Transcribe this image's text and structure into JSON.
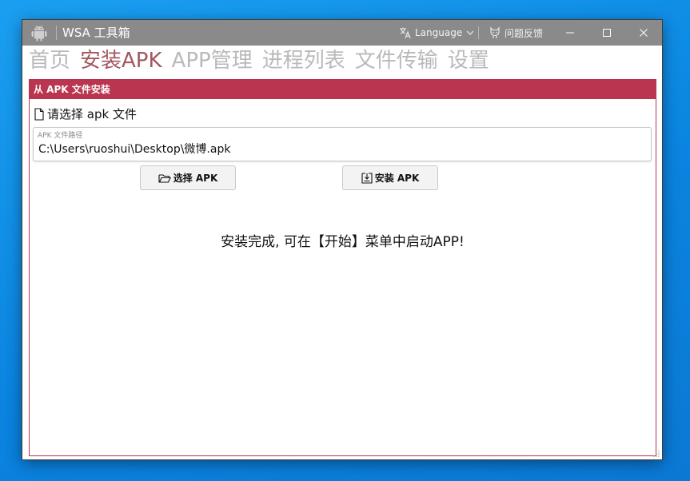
{
  "window": {
    "title": "WSA 工具箱",
    "language_label": "Language",
    "feedback_label": "问题反馈"
  },
  "nav": {
    "tabs": [
      {
        "label": "首页",
        "active": false
      },
      {
        "label": "安装APK",
        "active": true
      },
      {
        "label": "APP管理",
        "active": false
      },
      {
        "label": "进程列表",
        "active": false
      },
      {
        "label": "文件传输",
        "active": false
      },
      {
        "label": "设置",
        "active": false
      }
    ]
  },
  "install": {
    "header": "从 APK 文件安装",
    "section_label": "请选择 apk 文件",
    "path_label": "APK 文件路径",
    "path_value": "C:\\Users\\ruoshui\\Desktop\\微博.apk",
    "select_button": "选择 APK",
    "install_button": "安装 APK",
    "status_message": "安装完成, 可在【开始】菜单中启动APP!"
  },
  "colors": {
    "accent": "#b93550",
    "active_tab": "#a2585e",
    "inactive_tab": "#b9b9b9",
    "titlebar": "#8a8a8a",
    "desktop": "#0a84e0"
  },
  "icons": {
    "app": "android-icon",
    "language": "translate-icon",
    "feedback": "github-cat-icon",
    "section": "file-icon",
    "select": "folder-open-icon",
    "install": "install-download-icon"
  }
}
